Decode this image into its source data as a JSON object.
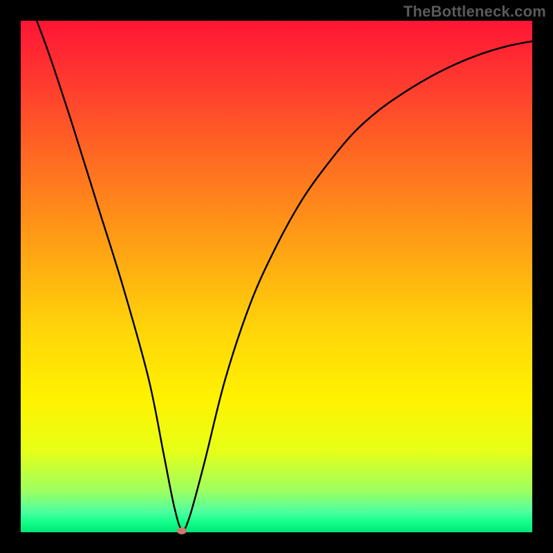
{
  "watermark": "TheBottleneck.com",
  "chart_data": {
    "type": "line",
    "title": "",
    "xlabel": "",
    "ylabel": "",
    "xlim": [
      0,
      100
    ],
    "ylim": [
      0,
      100
    ],
    "series": [
      {
        "name": "bottleneck-curve",
        "x": [
          0,
          5,
          10,
          15,
          20,
          25,
          28,
          30,
          31.5,
          33,
          36,
          40,
          45,
          50,
          55,
          60,
          65,
          70,
          75,
          80,
          85,
          90,
          95,
          100
        ],
        "y": [
          108,
          95,
          80,
          64,
          48,
          30,
          15,
          5,
          0.5,
          3,
          14,
          30,
          45,
          56,
          65,
          72,
          78,
          82.5,
          86,
          89,
          91.5,
          93.5,
          95,
          96
        ]
      }
    ],
    "marker": {
      "x": 31.5,
      "y": 0.3
    },
    "gradient_stops": [
      {
        "pos": 0,
        "color": "#ff1535"
      },
      {
        "pos": 60,
        "color": "#ffd40a"
      },
      {
        "pos": 100,
        "color": "#00e676"
      }
    ]
  }
}
